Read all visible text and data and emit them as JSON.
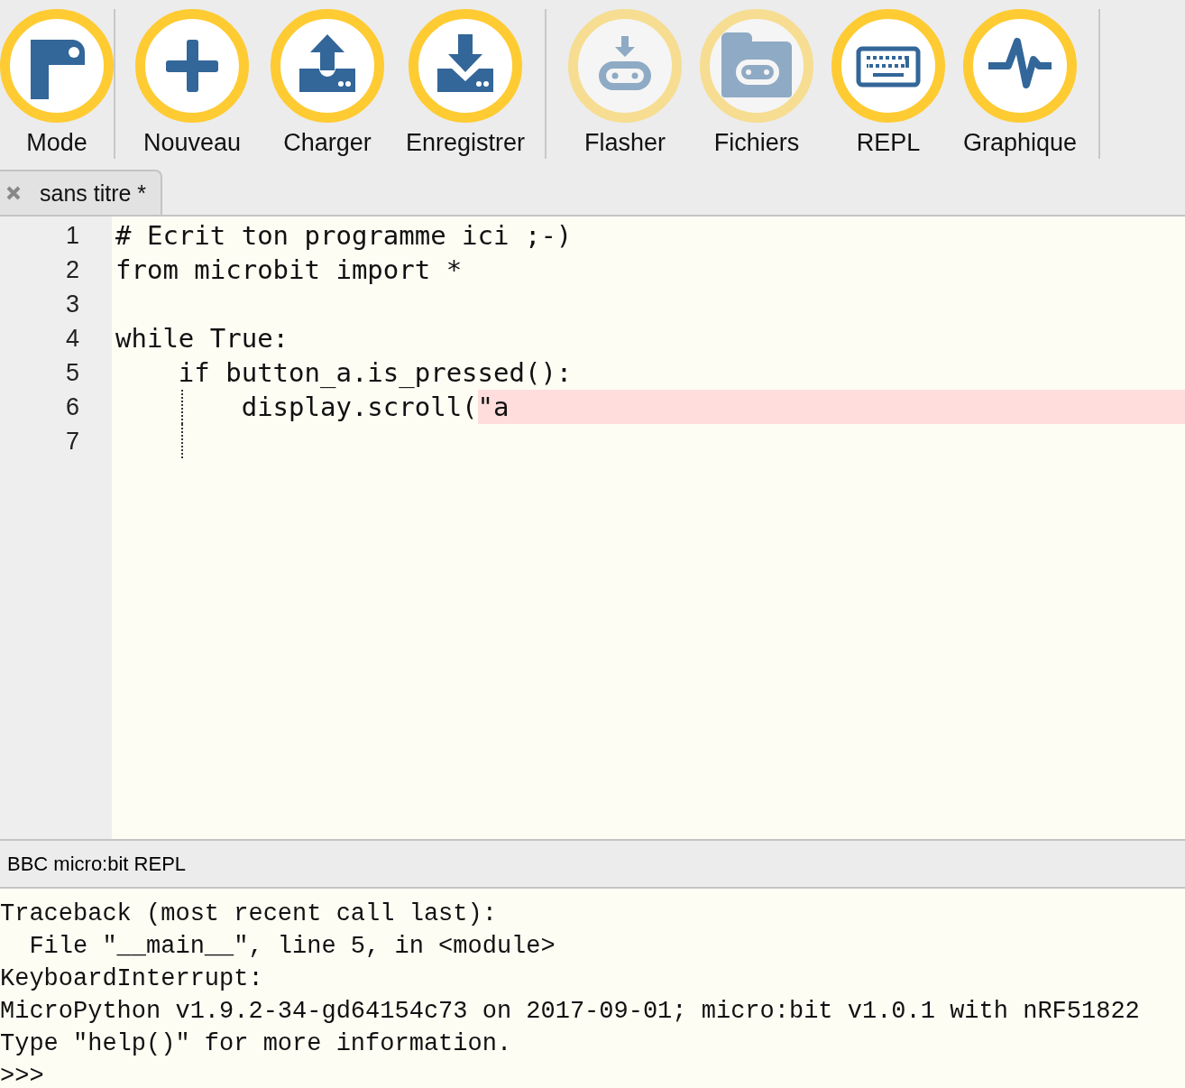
{
  "toolbar": {
    "groups": [
      [
        {
          "label": "Mode",
          "disabled": false
        }
      ],
      [
        {
          "label": "Nouveau",
          "disabled": false
        },
        {
          "label": "Charger",
          "disabled": false
        },
        {
          "label": "Enregistrer",
          "disabled": false
        }
      ],
      [
        {
          "label": "Flasher",
          "disabled": true
        },
        {
          "label": "Fichiers",
          "disabled": true
        },
        {
          "label": "REPL",
          "disabled": false
        },
        {
          "label": "Graphique",
          "disabled": false
        }
      ]
    ]
  },
  "tabs": [
    {
      "label": "sans titre *",
      "selected": true
    }
  ],
  "editor": {
    "lines": [
      {
        "number": "1",
        "code": "# Ecrit ton programme ici ;-)",
        "indent_guide": false
      },
      {
        "number": "2",
        "code": "from microbit import *",
        "indent_guide": false
      },
      {
        "number": "3",
        "indent_guide": false
      },
      {
        "number": "4",
        "code": "while True:",
        "indent_guide": false
      },
      {
        "number": "5",
        "code": "    if button_a.is_pressed():",
        "indent_guide": false
      },
      {
        "number": "6",
        "code": "        display.scroll(",
        "error": "\"a",
        "indent_guide": true
      },
      {
        "number": "7",
        "indent_guide": true
      }
    ]
  },
  "repl": {
    "title": "BBC micro:bit REPL",
    "lines": [
      "Traceback (most recent call last):",
      "  File \"__main__\", line 5, in <module>",
      "KeyboardInterrupt:",
      "MicroPython v1.9.2-34-gd64154c73 on 2017-09-01; micro:bit v1.0.1 with nRF51822",
      "Type \"help()\" for more information.",
      ">>>"
    ]
  }
}
